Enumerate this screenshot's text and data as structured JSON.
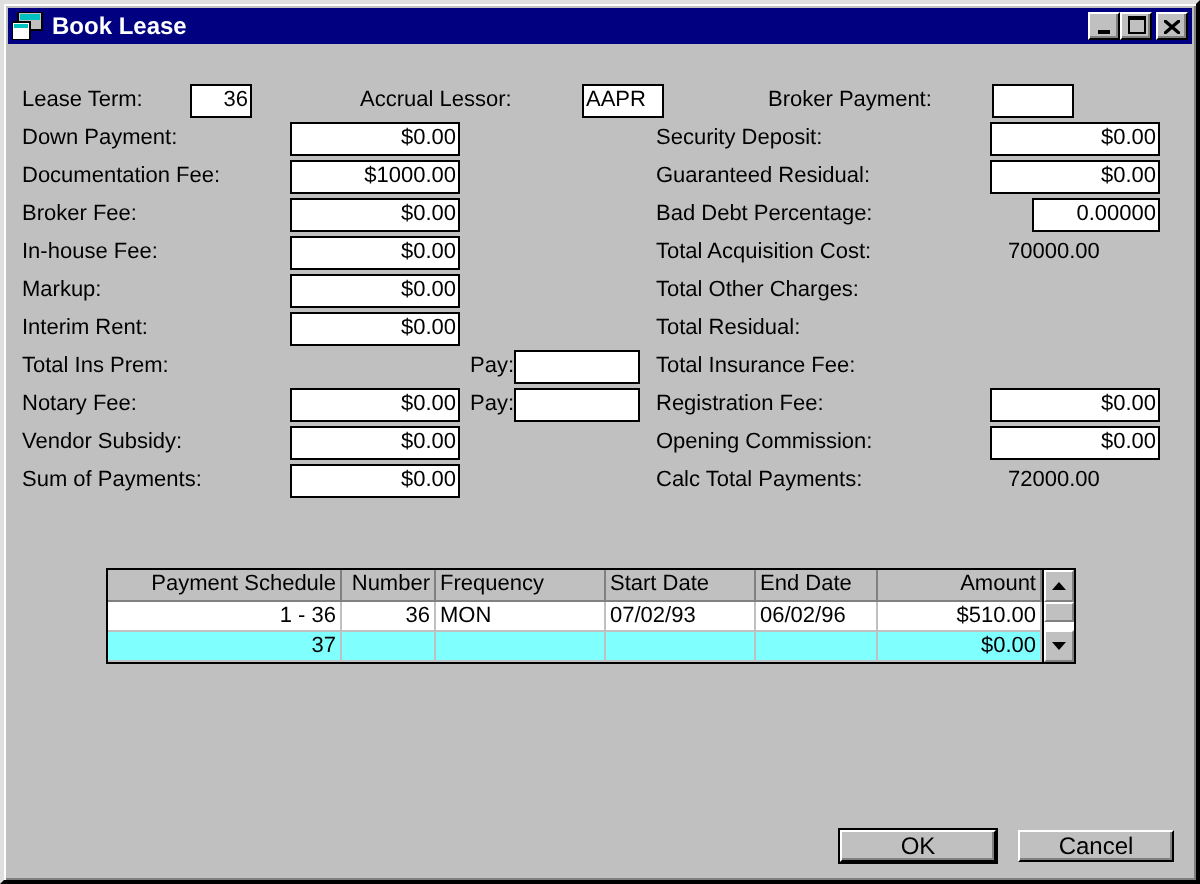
{
  "window": {
    "title": "Book Lease"
  },
  "top_row": [
    {
      "label": "Lease Term:",
      "value": "36"
    },
    {
      "label": "Accrual Lessor:",
      "value": "AAPR"
    },
    {
      "label": "Broker Payment:"
    }
  ],
  "rows": [
    {
      "left": {
        "label": "Down Payment:",
        "kind": "field",
        "value": "$0.00"
      },
      "right": {
        "label": "Security Deposit:",
        "kind": "field",
        "value": "$0.00"
      }
    },
    {
      "left": {
        "label": "Documentation Fee:",
        "kind": "field",
        "value": "$1000.00"
      },
      "right": {
        "label": "Guaranteed Residual:",
        "kind": "field",
        "value": "$0.00"
      }
    },
    {
      "left": {
        "label": "Broker Fee:",
        "kind": "field",
        "value": "$0.00"
      },
      "right": {
        "label": "Bad Debt Percentage:",
        "kind": "narrow_field",
        "value": "0.00000"
      }
    },
    {
      "left": {
        "label": "In-house Fee:",
        "kind": "field",
        "value": "$0.00"
      },
      "right": {
        "label": "Total Acquisition Cost:",
        "kind": "text",
        "value": "70000.00"
      }
    },
    {
      "left": {
        "label": "Markup:",
        "kind": "field",
        "value": "$0.00"
      },
      "right": {
        "label": "Total Other Charges:",
        "kind": "label"
      }
    },
    {
      "left": {
        "label": "Interim Rent:",
        "kind": "field",
        "value": "$0.00"
      },
      "right": {
        "label": "Total Residual:",
        "kind": "label"
      }
    },
    {
      "left": {
        "label": "Total Ins Prem:",
        "kind": "label"
      },
      "pay": {
        "label": "Pay:"
      },
      "right": {
        "label": "Total Insurance Fee:",
        "kind": "label"
      }
    },
    {
      "left": {
        "label": "Notary Fee:",
        "kind": "field",
        "value": "$0.00"
      },
      "pay": {
        "label": "Pay:"
      },
      "right": {
        "label": "Registration Fee:",
        "kind": "field",
        "value": "$0.00"
      }
    },
    {
      "left": {
        "label": "Vendor Subsidy:",
        "kind": "field",
        "value": "$0.00"
      },
      "right": {
        "label": "Opening Commission:",
        "kind": "field",
        "value": "$0.00"
      }
    },
    {
      "left": {
        "label": "Sum of Payments:",
        "kind": "field",
        "value": "$0.00"
      },
      "right": {
        "label": "Calc Total Payments:",
        "kind": "text",
        "value": "72000.00"
      }
    }
  ],
  "table": {
    "columns": [
      "Payment Schedule",
      "Number",
      "Frequency",
      "Start Date",
      "End Date",
      "Amount"
    ],
    "rows": [
      {
        "cells": [
          "1 - 36",
          "36",
          "MON",
          "07/02/93",
          "06/02/96",
          "$510.00"
        ],
        "selected": false
      },
      {
        "cells": [
          "37",
          "",
          "",
          "",
          "",
          "$0.00"
        ],
        "selected": true
      }
    ]
  },
  "buttons": [
    "OK",
    "Cancel"
  ]
}
